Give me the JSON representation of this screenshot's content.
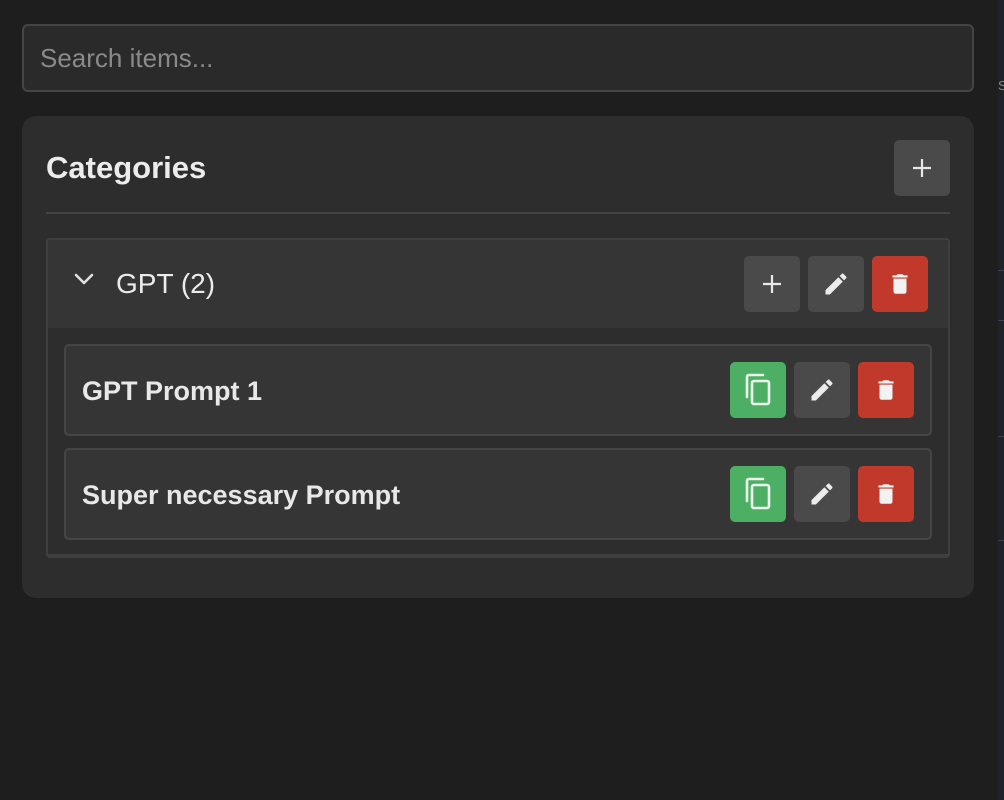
{
  "search": {
    "placeholder": "Search items...",
    "value": ""
  },
  "panel": {
    "title": "Categories"
  },
  "categories": [
    {
      "label": "GPT (2)",
      "expanded": true,
      "items": [
        {
          "label": "GPT Prompt 1"
        },
        {
          "label": "Super necessary Prompt"
        }
      ]
    }
  ],
  "edge": {
    "fragment": "S"
  },
  "icons": {
    "add": "plus-icon",
    "edit": "pencil-icon",
    "delete": "trash-icon",
    "copy": "copy-icon",
    "expand": "chevron-down-icon"
  },
  "colors": {
    "background": "#1e1e1e",
    "panel": "#2d2d2d",
    "copy_button": "#4caf63",
    "delete_button": "#c0392b",
    "neutral_button": "#4a4a4a"
  }
}
